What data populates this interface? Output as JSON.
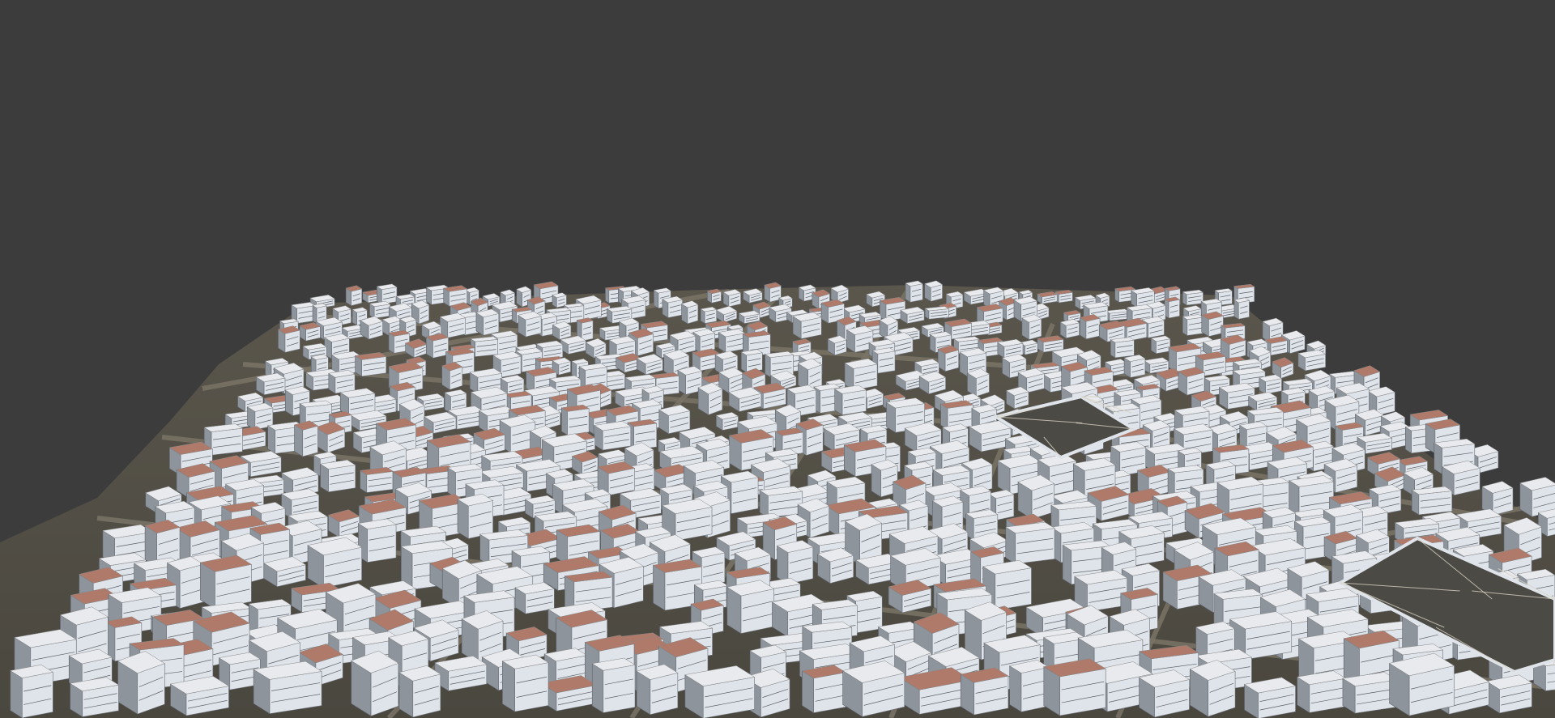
{
  "viewport": {
    "background_color": "#3c3c3c"
  },
  "scene": {
    "subject": "aerial-3d-city-model",
    "ground_color": "#55524a",
    "road_color": "#7a7466",
    "facade_white": "#dfe4ea",
    "facade_shadow": "#8d949c",
    "roof_red": "#b07a6a",
    "roof_white": "#e8eaee",
    "wire_color": "#d8d2c4"
  }
}
